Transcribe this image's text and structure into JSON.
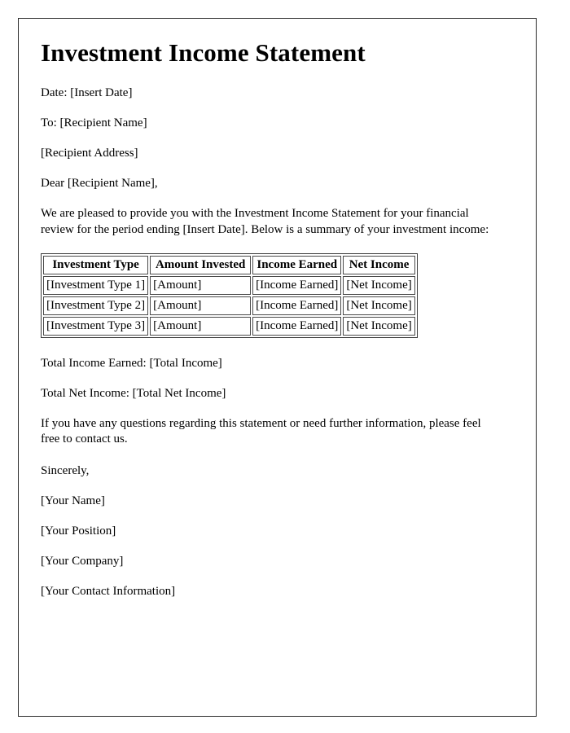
{
  "document": {
    "title": "Investment Income Statement",
    "date_line": "Date: [Insert Date]",
    "to_line": "To: [Recipient Name]",
    "address_line": "[Recipient Address]",
    "salutation": "Dear [Recipient Name],",
    "intro_paragraph": "We are pleased to provide you with the Investment Income Statement for your financial review for the period ending [Insert Date]. Below is a summary of your investment income:",
    "total_income_line": "Total Income Earned: [Total Income]",
    "total_net_income_line": "Total Net Income: [Total Net Income]",
    "closing_paragraph": "If you have any questions regarding this statement or need further information, please feel free to contact us.",
    "sign_off": "Sincerely,",
    "signature": {
      "name": "[Your Name]",
      "position": "[Your Position]",
      "company": "[Your Company]",
      "contact": "[Your Contact Information]"
    }
  },
  "table": {
    "headers": [
      "Investment Type",
      "Amount Invested",
      "Income Earned",
      "Net Income"
    ],
    "rows": [
      [
        "[Investment Type 1]",
        "[Amount]",
        "[Income Earned]",
        "[Net Income]"
      ],
      [
        "[Investment Type 2]",
        "[Amount]",
        "[Income Earned]",
        "[Net Income]"
      ],
      [
        "[Investment Type 3]",
        "[Amount]",
        "[Income Earned]",
        "[Net Income]"
      ]
    ]
  },
  "colors": {
    "page_border": "#2b2b2b",
    "table_border": "#4a4a4a",
    "text": "#000000",
    "background": "#ffffff"
  }
}
